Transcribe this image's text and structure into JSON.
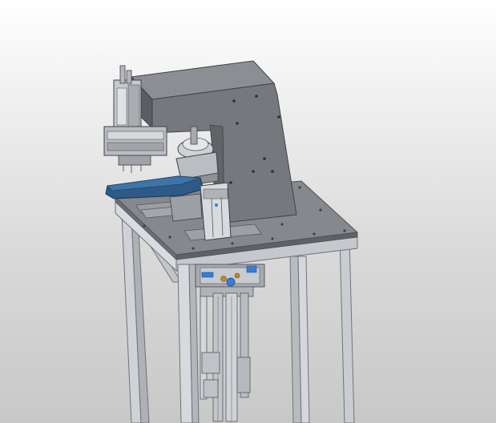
{
  "scene": {
    "subject": "cad-machine-assembly",
    "colors": {
      "background_top": "#ffffff",
      "background_bottom": "#c8c8c8",
      "frame": "#c9ccd0",
      "frame_edge": "#6f7378",
      "body": "#6f7276",
      "body_dark": "#55585c",
      "table_top": "#7e8185",
      "pad_arm": "#2d5a86",
      "fitting_blue": "#3a7cd6",
      "fitting_brass": "#b98a2e"
    }
  }
}
